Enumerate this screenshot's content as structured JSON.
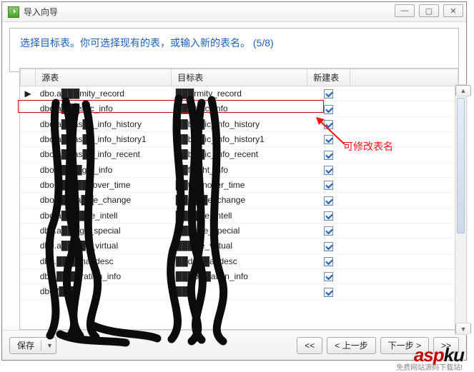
{
  "window": {
    "title": "导入向导"
  },
  "banner": {
    "text": "选择目标表。你可选择现有的表，或输入新的表名。 (5/8)"
  },
  "table": {
    "headers": {
      "source": "源表",
      "target": "目标表",
      "newtable": "新建表"
    },
    "rows": [
      {
        "source": "dbo.a███mity_record",
        "target": "███rmity_record",
        "new": true,
        "selected": true
      },
      {
        "source": "dbo.a███s█c_info",
        "target": "███asic_info",
        "new": true
      },
      {
        "source": "dbo.a██as█c_info_history",
        "target": "██b██ic_info_history",
        "new": true
      },
      {
        "source": "dbo.a██as█c_info_history1",
        "target": "██b██ic_info_history1",
        "new": true
      },
      {
        "source": "dbo.a██as█c_info_recent",
        "target": "██b██ic_info_recent",
        "new": true
      },
      {
        "source": "dbo.a██f█ght_info",
        "target": "██f██ht_info",
        "new": true
      },
      {
        "source": "dbo.a██t██nover_time",
        "target": "██t██nover_time",
        "new": true
      },
      {
        "source": "dbo.a██ra██e_change",
        "target": "██ra██e_change",
        "new": true
      },
      {
        "source": "dbo.a████ge_intell",
        "target": "████ge_intell",
        "new": true
      },
      {
        "source": "dbo.a███ge_special",
        "target": "███nge_special",
        "new": true
      },
      {
        "source": "dbo.a████e_virtual",
        "target": "████e_virtual",
        "new": true
      },
      {
        "source": "dbo.████napdesc",
        "target": "██de██apdesc",
        "new": true
      },
      {
        "source": "dbo.████ration_info",
        "target": "███p██ation_info",
        "new": true
      },
      {
        "source": "dbo.f███",
        "target": "██",
        "new": true
      }
    ]
  },
  "annotation": {
    "text": "可修改表名"
  },
  "footer": {
    "save": "保存",
    "first": "<<",
    "prev": "< 上一步",
    "next": "下一步 >",
    "last": ">>"
  },
  "watermark": {
    "logo_part1": "asp",
    "logo_part2": "ku",
    "subtext": "免费网站源码下载站!"
  },
  "colors": {
    "link_blue": "#1b5fb8",
    "accent_red": "#d40000"
  }
}
